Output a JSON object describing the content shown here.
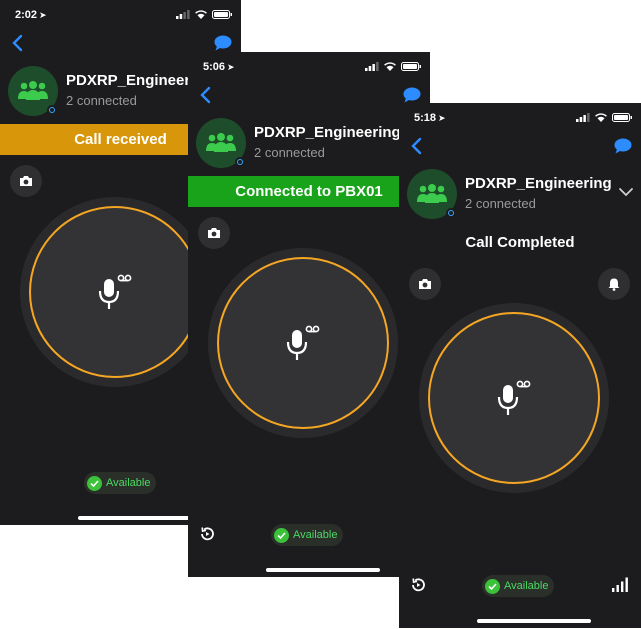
{
  "colors": {
    "background": "#1c1c1e",
    "accent_blue": "#2d8cff",
    "ring_orange": "#f5a623",
    "banner_received": "#d8970b",
    "banner_connected": "#19a31a",
    "available_green": "#4cd964",
    "avatar_green": "#3ccb4c"
  },
  "screens": [
    {
      "time": "2:02",
      "channel": {
        "name": "PDXRP_Engineering",
        "subtitle": "2 connected"
      },
      "banner": "Call received",
      "status": "Available"
    },
    {
      "time": "5:06",
      "channel": {
        "name": "PDXRP_Engineering",
        "subtitle": "2 connected"
      },
      "banner": "Connected to PBX01",
      "status": "Available"
    },
    {
      "time": "5:18",
      "channel": {
        "name": "PDXRP_Engineering",
        "subtitle": "2 connected"
      },
      "banner": "Call Completed",
      "status": "Available"
    }
  ],
  "icons": {
    "back": "chevron-left-icon",
    "chat": "chat-bubble-icon",
    "group": "group-icon",
    "camera": "camera-icon",
    "microphone": "microphone-voicemail-icon",
    "bell": "bell-icon",
    "history": "history-replay-icon",
    "signal": "signal-bars-icon",
    "expand": "chevron-down-icon"
  }
}
